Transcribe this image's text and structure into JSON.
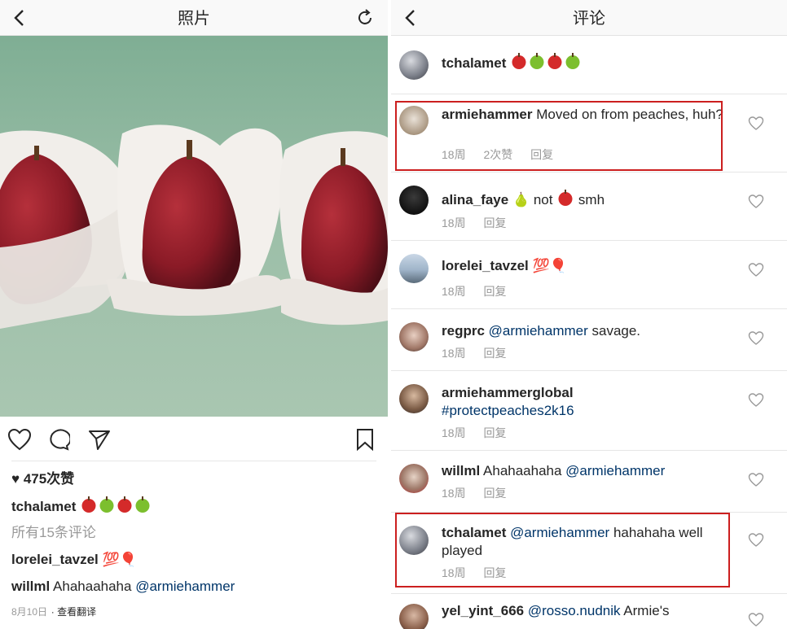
{
  "left": {
    "nav": {
      "title": "照片"
    },
    "likes": "♥ 475次赞",
    "caption": {
      "user": "tchalamet"
    },
    "view_all": "所有15条评论",
    "comments": [
      {
        "user": "lorelei_tavzel",
        "text": "💯🎈"
      },
      {
        "user": "willml",
        "text": "Ahahaahaha",
        "mention": "@armiehammer"
      }
    ],
    "date": "8月10日",
    "translate": "· 查看翻译"
  },
  "right": {
    "nav": {
      "title": "评论"
    },
    "comments": [
      {
        "user": "tchalamet",
        "text": "",
        "age": "",
        "likes": "",
        "reply": ""
      },
      {
        "user": "armiehammer",
        "text": " Moved on from peaches, huh?",
        "age": "18周",
        "likes": "2次赞",
        "reply": "回复"
      },
      {
        "user": "alina_faye",
        "text_a": " 🍐 not ",
        "text_b": " smh",
        "age": "18周",
        "reply": "回复"
      },
      {
        "user": "lorelei_tavzel",
        "text": " 💯🎈",
        "age": "18周",
        "reply": "回复"
      },
      {
        "user": "regprc",
        "mention": " @armiehammer",
        "text": " savage.",
        "age": "18周",
        "reply": "回复"
      },
      {
        "user": "armiehammerglobal",
        "tag": "#protectpeaches2k16",
        "age": "18周",
        "reply": "回复"
      },
      {
        "user": "willml",
        "text": " Ahahaahaha",
        "mention": " @armiehammer",
        "age": "18周",
        "reply": "回复"
      },
      {
        "user": "tchalamet",
        "mention": " @armiehammer",
        "text": " hahahaha well played",
        "age": "18周",
        "reply": "回复"
      },
      {
        "user": "yel_yint_666",
        "mention": " @rosso.nudnik",
        "text": " Armie's"
      }
    ]
  },
  "colors": {
    "highlight": "#cc1f1f",
    "link": "#003569",
    "muted": "#999999",
    "apple_red": "#d42a2a",
    "apple_green": "#7cbf2e"
  }
}
